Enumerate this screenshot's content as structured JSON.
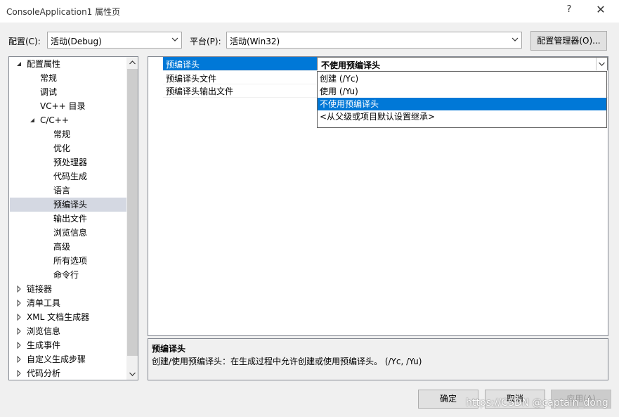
{
  "window": {
    "title": "ConsoleApplication1 属性页",
    "help_glyph": "?",
    "close_glyph": "✕"
  },
  "config": {
    "config_label": "配置(C):",
    "config_value": "活动(Debug)",
    "platform_label": "平台(P):",
    "platform_value": "活动(Win32)",
    "manager_button": "配置管理器(O)..."
  },
  "tree": {
    "items": [
      {
        "label": "配置属性",
        "expander": "expanded"
      },
      {
        "label": "常规",
        "expander": "none"
      },
      {
        "label": "调试",
        "expander": "none"
      },
      {
        "label": "VC++ 目录",
        "expander": "none"
      },
      {
        "label": "C/C++",
        "expander": "expanded"
      },
      {
        "label": "常规",
        "expander": "none"
      },
      {
        "label": "优化",
        "expander": "none"
      },
      {
        "label": "预处理器",
        "expander": "none"
      },
      {
        "label": "代码生成",
        "expander": "none"
      },
      {
        "label": "语言",
        "expander": "none"
      },
      {
        "label": "预编译头",
        "expander": "none",
        "selected": true
      },
      {
        "label": "输出文件",
        "expander": "none"
      },
      {
        "label": "浏览信息",
        "expander": "none"
      },
      {
        "label": "高级",
        "expander": "none"
      },
      {
        "label": "所有选项",
        "expander": "none"
      },
      {
        "label": "命令行",
        "expander": "none"
      },
      {
        "label": "链接器",
        "expander": "collapsed"
      },
      {
        "label": "清单工具",
        "expander": "collapsed"
      },
      {
        "label": "XML 文档生成器",
        "expander": "collapsed"
      },
      {
        "label": "浏览信息",
        "expander": "collapsed"
      },
      {
        "label": "生成事件",
        "expander": "collapsed"
      },
      {
        "label": "自定义生成步骤",
        "expander": "collapsed"
      },
      {
        "label": "代码分析",
        "expander": "collapsed"
      }
    ]
  },
  "grid": {
    "rows": [
      {
        "name": "预编译头",
        "value": "不使用预编译头"
      },
      {
        "name": "预编译头文件",
        "value": ""
      },
      {
        "name": "预编译头输出文件",
        "value": ""
      }
    ],
    "dropdown_options": [
      {
        "label": "创建 (/Yc)"
      },
      {
        "label": "使用 (/Yu)"
      },
      {
        "label": "不使用预编译头",
        "highlighted": true
      },
      {
        "label": "<从父级或项目默认设置继承>"
      }
    ]
  },
  "description": {
    "title": "预编译头",
    "text": "创建/使用预编译头：在生成过程中允许创建或使用预编译头。      (/Yc, /Yu)"
  },
  "buttons": {
    "ok": "确定",
    "cancel": "取消",
    "apply": "应用(A)"
  },
  "watermark": "https://CSDN @captain_dong",
  "colors": {
    "selection_blue": "#0078d7",
    "tree_selection": "#d4d8e2",
    "background": "#f0f0f0"
  }
}
